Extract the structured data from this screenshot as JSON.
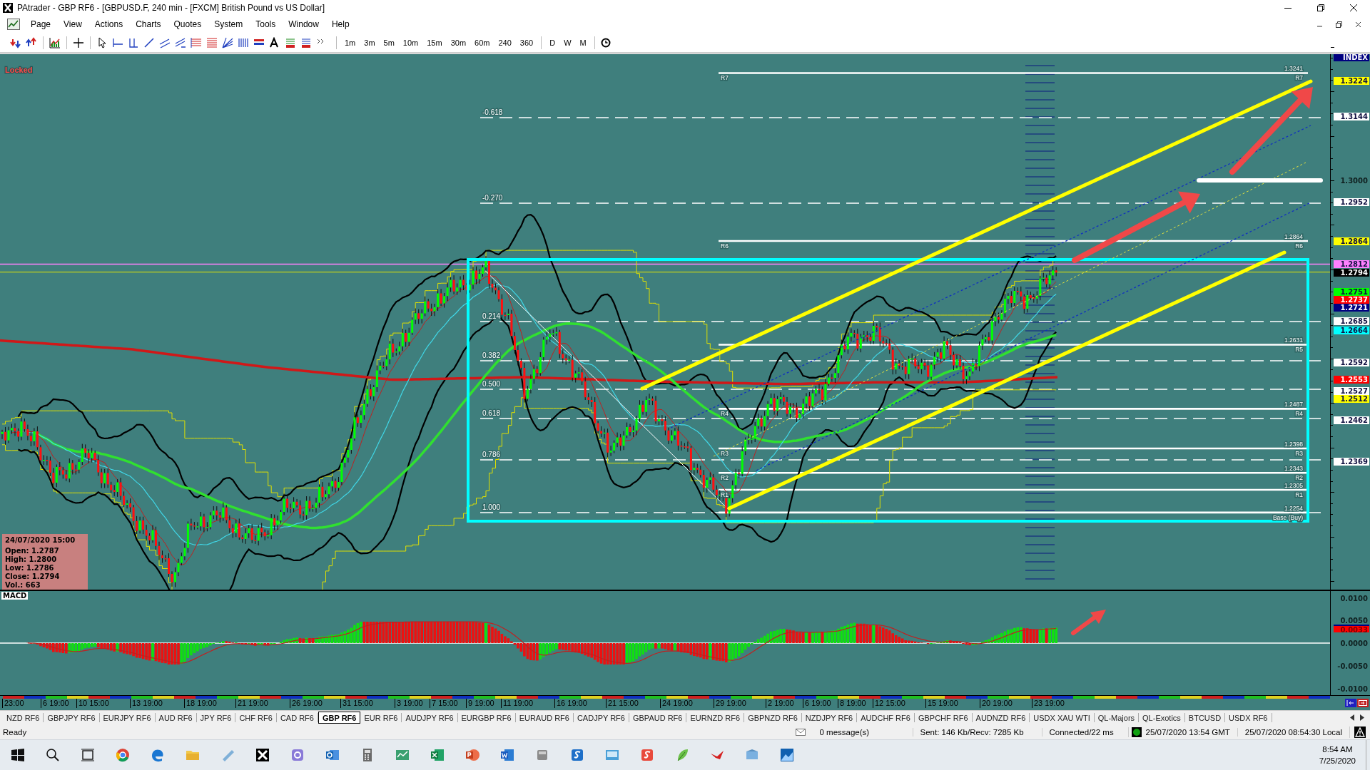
{
  "window": {
    "title": "PAtrader - GBP RF6 - [GBPUSD.F, 240 min - [FXCM] British Pound vs US Dollar]"
  },
  "menu": [
    "Page",
    "View",
    "Actions",
    "Charts",
    "Quotes",
    "System",
    "Tools",
    "Window",
    "Help"
  ],
  "toolbar": {
    "timeframes": [
      "1m",
      "3m",
      "5m",
      "10m",
      "15m",
      "30m",
      "60m",
      "240",
      "360"
    ],
    "periods": [
      "D",
      "W",
      "M"
    ]
  },
  "chart": {
    "locked_label": "Locked",
    "axis_header": "INDEX",
    "price_labels": [
      {
        "text": "1.3224",
        "kind": "marker",
        "color": "#ffff00"
      },
      {
        "text": "1.3144",
        "kind": "marker",
        "color": "#ffffff"
      },
      {
        "text": "1.3000",
        "kind": "tick"
      },
      {
        "text": "1.2952",
        "kind": "marker",
        "color": "#ffffff"
      },
      {
        "text": "1.2864",
        "kind": "marker",
        "color": "#ffff00"
      },
      {
        "text": "1.2812",
        "kind": "marker",
        "color": "#ff80ff"
      },
      {
        "text": "1.2794",
        "kind": "marker",
        "color": "#000000"
      },
      {
        "text": "1.2751",
        "kind": "marker",
        "color": "#00ff00"
      },
      {
        "text": "1.2737",
        "kind": "marker",
        "color": "#ff0000"
      },
      {
        "text": "1.2721",
        "kind": "marker",
        "color": "#000080"
      },
      {
        "text": "1.2685",
        "kind": "marker",
        "color": "#ffffff"
      },
      {
        "text": "1.2664",
        "kind": "marker",
        "color": "#00ffff"
      },
      {
        "text": "1.2592",
        "kind": "marker",
        "color": "#ffffff"
      },
      {
        "text": "1.2553",
        "kind": "marker",
        "color": "#ff0000"
      },
      {
        "text": "1.2527",
        "kind": "marker",
        "color": "#ffffff"
      },
      {
        "text": "1.2512",
        "kind": "marker",
        "color": "#ffff00"
      },
      {
        "text": "1.2462",
        "kind": "marker",
        "color": "#ffffff"
      },
      {
        "text": "1.2369",
        "kind": "marker",
        "color": "#ffffff"
      }
    ],
    "fib_labels": [
      "-0.618",
      "-0.270",
      "0.214",
      "0.382",
      "0.500",
      "0.618",
      "0.786",
      "1.000"
    ],
    "pivots": [
      {
        "left_label": "R7",
        "value": "1.3241",
        "right_label": "R7"
      },
      {
        "left_label": "R6",
        "value": "1.2864",
        "right_label": "R6"
      },
      {
        "value": "1.2631",
        "right_label": "R5"
      },
      {
        "left_label": "R4",
        "value": "1.2487",
        "right_label": "R4"
      },
      {
        "left_label": "R3",
        "value": "1.2398",
        "right_label": "R3"
      },
      {
        "left_label": "R2",
        "value": "1.2343",
        "right_label": "R2"
      },
      {
        "left_label": "R1",
        "value": "1.2305",
        "right_label": "R1"
      },
      {
        "value": "1.2254",
        "right_label": "Base (Buy)"
      }
    ],
    "info": {
      "date": "24/07/2020 15:00",
      "lines": [
        "Open: 1.2787",
        "High: 1.2800",
        "Low: 1.2786",
        "Close: 1.2794",
        "Vol.: 663"
      ]
    },
    "macd": {
      "title": "MACD",
      "axis_labels": [
        "0.0100",
        "0.0050",
        "0.0000",
        "-0.0050",
        "-0.0100"
      ],
      "current": "0.0033"
    },
    "time_labels": [
      "23:00",
      "6 19:00",
      "10 15:00",
      "13 19:00",
      "18 19:00",
      "21 19:00",
      "26 19:00",
      "31 15:00",
      "3 19:00",
      "7 15:00",
      "9 19:00",
      "11 19:00",
      "16 19:00",
      "21 15:00",
      "24 19:00",
      "29 19:00",
      "2 19:00",
      "6 19:00",
      "8 19:00",
      "12 15:00",
      "15 19:00",
      "20 19:00",
      "23 19:00"
    ]
  },
  "tabs": [
    {
      "label": "NZD RF6",
      "selected": false
    },
    {
      "label": "GBPJPY RF6",
      "selected": false
    },
    {
      "label": "EURJPY RF6",
      "selected": false
    },
    {
      "label": "AUD RF6",
      "selected": false
    },
    {
      "label": "JPY RF6",
      "selected": false
    },
    {
      "label": "CHF RF6",
      "selected": false
    },
    {
      "label": "CAD RF6",
      "selected": false
    },
    {
      "label": "GBP RF6",
      "selected": true
    },
    {
      "label": "EUR RF6",
      "selected": false
    },
    {
      "label": "AUDJPY RF6",
      "selected": false
    },
    {
      "label": "EURGBP RF6",
      "selected": false
    },
    {
      "label": "EURAUD RF6",
      "selected": false
    },
    {
      "label": "CADJPY RF6",
      "selected": false
    },
    {
      "label": "GBPAUD RF6",
      "selected": false
    },
    {
      "label": "EURNZD RF6",
      "selected": false
    },
    {
      "label": "GBPNZD RF6",
      "selected": false
    },
    {
      "label": "NZDJPY RF6",
      "selected": false
    },
    {
      "label": "AUDCHF RF6",
      "selected": false
    },
    {
      "label": "GBPCHF RF6",
      "selected": false
    },
    {
      "label": "AUDNZD RF6",
      "selected": false
    },
    {
      "label": "USDX XAU WTI",
      "selected": false
    },
    {
      "label": "QL-Majors",
      "selected": false
    },
    {
      "label": "QL-Exotics",
      "selected": false
    },
    {
      "label": "BTCUSD",
      "selected": false
    },
    {
      "label": "USDX RF6",
      "selected": false
    }
  ],
  "status_bar": {
    "state": "Ready",
    "messages": "0 message(s)",
    "traffic": "Sent: 146 Kb/Recv: 7285 Kb",
    "connection": "Connected/22 ms",
    "gmt_time": "25/07/2020 13:54 GMT",
    "local_time": "25/07/2020 08:54:30 Local"
  },
  "taskbar": {
    "time": "8:54 AM",
    "date": "7/25/2020"
  }
}
